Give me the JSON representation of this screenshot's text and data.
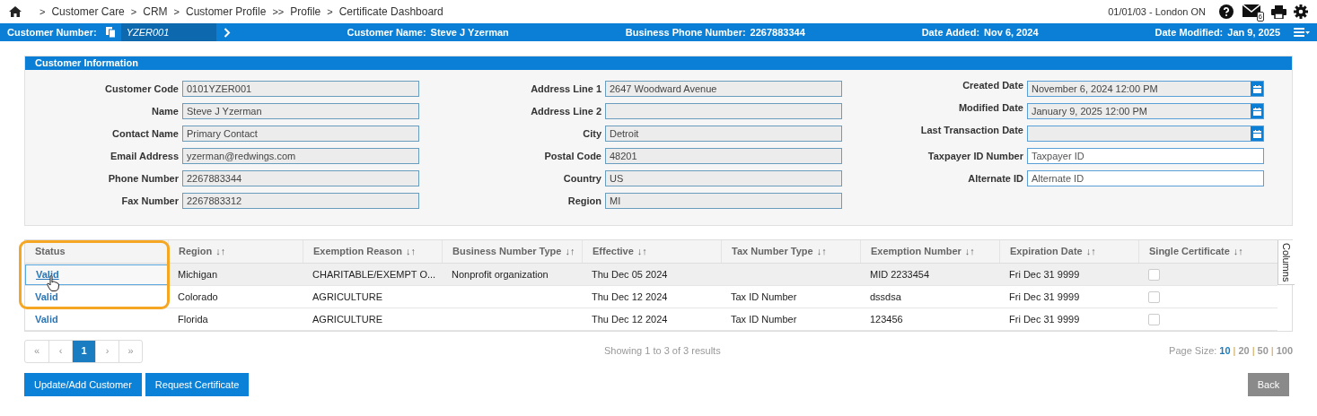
{
  "breadcrumb": [
    {
      "separator": ">",
      "label": "Customer Care"
    },
    {
      "separator": ">",
      "label": "CRM"
    },
    {
      "separator": ">",
      "label": "Customer Profile"
    },
    {
      "separator": ">>",
      "label": "Profile"
    },
    {
      "separator": ">",
      "label": "Certificate Dashboard"
    }
  ],
  "top_right": {
    "location": "01/01/03 - London ON",
    "mail_count": "6"
  },
  "header_bar": {
    "customer_number": {
      "label": "Customer Number:",
      "value": "YZER001"
    },
    "fields": [
      {
        "label": "Customer Name:",
        "value": "Steve J Yzerman"
      },
      {
        "label": "Business Phone Number:",
        "value": "2267883344"
      },
      {
        "label": "Date Added:",
        "value": "Nov 6, 2024"
      },
      {
        "label": "Date Modified:",
        "value": "Jan 9, 2025"
      }
    ]
  },
  "customer_info": {
    "title": "Customer Information",
    "columns": [
      [
        {
          "kind": "readonly",
          "label": "Customer Code",
          "value": "0101YZER001"
        },
        {
          "kind": "readonly",
          "label": "Name",
          "value": "Steve J Yzerman"
        },
        {
          "kind": "readonly",
          "label": "Contact Name",
          "value": "Primary Contact"
        },
        {
          "kind": "readonly",
          "label": "Email Address",
          "value": "yzerman@redwings.com"
        },
        {
          "kind": "readonly",
          "label": "Phone Number",
          "value": "2267883344"
        },
        {
          "kind": "readonly",
          "label": "Fax Number",
          "value": "2267883312"
        }
      ],
      [
        {
          "kind": "readonly",
          "label": "Address Line 1",
          "value": "2647 Woodward Avenue"
        },
        {
          "kind": "readonly",
          "label": "Address Line 2"
        },
        {
          "kind": "readonly",
          "label": "City",
          "value": "Detroit"
        },
        {
          "kind": "readonly",
          "label": "Postal Code",
          "value": "48201"
        },
        {
          "kind": "readonly",
          "label": "Country",
          "value": "US"
        },
        {
          "kind": "readonly",
          "label": "Region",
          "value": "MI"
        }
      ],
      [
        {
          "kind": "date",
          "label": "Created Date",
          "value": "November 6, 2024 12:00 PM"
        },
        {
          "kind": "date",
          "label": "Modified Date",
          "value": "January 9, 2025 12:00 PM"
        },
        {
          "kind": "date",
          "label": "Last Transaction Date"
        },
        {
          "kind": "editable",
          "label": "Taxpayer ID Number",
          "placeholder": "Taxpayer ID"
        },
        {
          "kind": "editable",
          "label": "Alternate ID",
          "placeholder": "Alternate ID"
        }
      ]
    ]
  },
  "table": {
    "columns": [
      {
        "label": "Status",
        "sortable": false
      },
      {
        "label": "Region",
        "sortable": true
      },
      {
        "label": "Exemption Reason",
        "sortable": true
      },
      {
        "label": "Business Number Type",
        "sortable": true
      },
      {
        "label": "Effective",
        "sortable": true
      },
      {
        "label": "Tax Number Type",
        "sortable": true
      },
      {
        "label": "Exemption Number",
        "sortable": true
      },
      {
        "label": "Expiration Date",
        "sortable": true
      },
      {
        "label": "Single Certificate",
        "sortable": true
      }
    ],
    "sort_icon": "↓↑",
    "side_tab": "Columns",
    "rows": [
      {
        "selected": true,
        "cells": [
          "Valid",
          "Michigan",
          "CHARITABLE/EXEMPT O...",
          "Nonprofit organization",
          "Thu Dec 05 2024",
          "",
          "MID 2233454",
          "Fri Dec 31 9999"
        ],
        "single_certificate": false
      },
      {
        "selected": false,
        "cells": [
          "Valid",
          "Colorado",
          "AGRICULTURE",
          "",
          "Thu Dec 12 2024",
          "Tax ID Number",
          "dssdsa",
          "Fri Dec 31 9999"
        ],
        "single_certificate": false
      },
      {
        "selected": false,
        "cells": [
          "Valid",
          "Florida",
          "AGRICULTURE",
          "",
          "Thu Dec 12 2024",
          "Tax ID Number",
          "123456",
          "Fri Dec 31 9999"
        ],
        "single_certificate": false
      }
    ]
  },
  "pagination": {
    "pages": [
      {
        "label": "«",
        "selected": false
      },
      {
        "label": "‹",
        "selected": false
      },
      {
        "label": "1",
        "selected": true
      },
      {
        "label": "›",
        "selected": false
      },
      {
        "label": "»",
        "selected": false
      }
    ],
    "summary": "Showing 1 to 3 of 3 results",
    "page_size_label": "Page Size:",
    "page_sizes": [
      {
        "label": "10",
        "selected": true
      },
      {
        "label": "20",
        "selected": false
      },
      {
        "label": "50",
        "selected": false
      },
      {
        "label": "100",
        "selected": false
      }
    ],
    "page_size_separator": "|"
  },
  "buttons": [
    {
      "kind": "primary",
      "label": "Update/Add Customer"
    },
    {
      "kind": "primary",
      "label": "Request Certificate"
    },
    {
      "kind": "secondary",
      "label": "Back"
    }
  ]
}
